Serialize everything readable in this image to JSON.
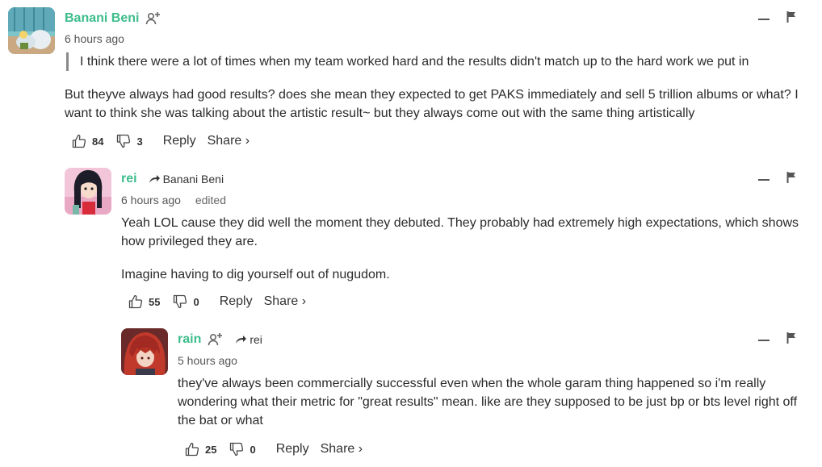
{
  "comments": [
    {
      "author": "Banani Beni",
      "time": "6 hours ago",
      "quote": "I think there were a lot of times when my team worked hard and the results didn't match up to the hard work we put in",
      "text": "But theyve always had good results? does she mean they expected to get PAKS immediately and sell 5 trillion albums or what? I want to think she was talking about the artistic result~ but they always come out with the same thing artistically",
      "likes": "84",
      "dislikes": "3",
      "reply_label": "Reply",
      "share_label": "Share ›"
    },
    {
      "author": "rei",
      "reply_to": "Banani Beni",
      "time": "6 hours ago",
      "edited": "edited",
      "text1": "Yeah LOL cause they did well the moment they debuted. They probably had extremely high expectations, which shows how privileged they are.",
      "text2": "Imagine having to dig yourself out of nugudom.",
      "likes": "55",
      "dislikes": "0",
      "reply_label": "Reply",
      "share_label": "Share ›"
    },
    {
      "author": "rain",
      "reply_to": "rei",
      "time": "5 hours ago",
      "text": "they've always been commercially successful even when the whole garam thing happened so i'm really wondering what their metric for \"great results\" mean. like are they supposed to be just bp or bts level right off the bat or what",
      "likes": "25",
      "dislikes": "0",
      "reply_label": "Reply",
      "share_label": "Share ›"
    }
  ],
  "icons": {
    "thumbs_up": "thumbs-up-icon",
    "thumbs_down": "thumbs-down-icon",
    "follow": "add-user-icon",
    "reply_arrow": "reply-arrow-icon",
    "collapse": "collapse-icon",
    "flag": "flag-icon"
  },
  "colors": {
    "author": "#3dbd8c",
    "text": "#2a2a2a",
    "quote_bar": "#8a8a8a"
  }
}
